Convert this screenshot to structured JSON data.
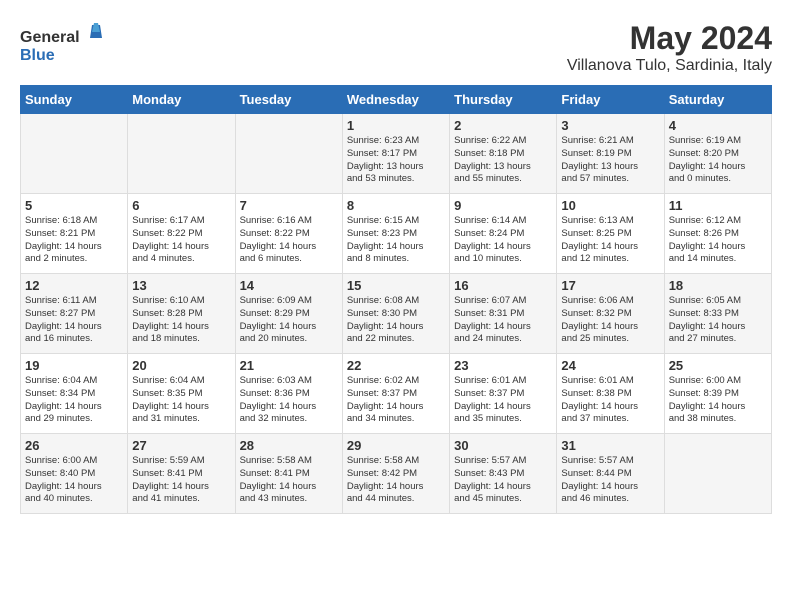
{
  "header": {
    "logo_general": "General",
    "logo_blue": "Blue",
    "month_year": "May 2024",
    "location": "Villanova Tulo, Sardinia, Italy"
  },
  "days_of_week": [
    "Sunday",
    "Monday",
    "Tuesday",
    "Wednesday",
    "Thursday",
    "Friday",
    "Saturday"
  ],
  "weeks": [
    [
      {
        "day": "",
        "info": ""
      },
      {
        "day": "",
        "info": ""
      },
      {
        "day": "",
        "info": ""
      },
      {
        "day": "1",
        "info": "Sunrise: 6:23 AM\nSunset: 8:17 PM\nDaylight: 13 hours\nand 53 minutes."
      },
      {
        "day": "2",
        "info": "Sunrise: 6:22 AM\nSunset: 8:18 PM\nDaylight: 13 hours\nand 55 minutes."
      },
      {
        "day": "3",
        "info": "Sunrise: 6:21 AM\nSunset: 8:19 PM\nDaylight: 13 hours\nand 57 minutes."
      },
      {
        "day": "4",
        "info": "Sunrise: 6:19 AM\nSunset: 8:20 PM\nDaylight: 14 hours\nand 0 minutes."
      }
    ],
    [
      {
        "day": "5",
        "info": "Sunrise: 6:18 AM\nSunset: 8:21 PM\nDaylight: 14 hours\nand 2 minutes."
      },
      {
        "day": "6",
        "info": "Sunrise: 6:17 AM\nSunset: 8:22 PM\nDaylight: 14 hours\nand 4 minutes."
      },
      {
        "day": "7",
        "info": "Sunrise: 6:16 AM\nSunset: 8:22 PM\nDaylight: 14 hours\nand 6 minutes."
      },
      {
        "day": "8",
        "info": "Sunrise: 6:15 AM\nSunset: 8:23 PM\nDaylight: 14 hours\nand 8 minutes."
      },
      {
        "day": "9",
        "info": "Sunrise: 6:14 AM\nSunset: 8:24 PM\nDaylight: 14 hours\nand 10 minutes."
      },
      {
        "day": "10",
        "info": "Sunrise: 6:13 AM\nSunset: 8:25 PM\nDaylight: 14 hours\nand 12 minutes."
      },
      {
        "day": "11",
        "info": "Sunrise: 6:12 AM\nSunset: 8:26 PM\nDaylight: 14 hours\nand 14 minutes."
      }
    ],
    [
      {
        "day": "12",
        "info": "Sunrise: 6:11 AM\nSunset: 8:27 PM\nDaylight: 14 hours\nand 16 minutes."
      },
      {
        "day": "13",
        "info": "Sunrise: 6:10 AM\nSunset: 8:28 PM\nDaylight: 14 hours\nand 18 minutes."
      },
      {
        "day": "14",
        "info": "Sunrise: 6:09 AM\nSunset: 8:29 PM\nDaylight: 14 hours\nand 20 minutes."
      },
      {
        "day": "15",
        "info": "Sunrise: 6:08 AM\nSunset: 8:30 PM\nDaylight: 14 hours\nand 22 minutes."
      },
      {
        "day": "16",
        "info": "Sunrise: 6:07 AM\nSunset: 8:31 PM\nDaylight: 14 hours\nand 24 minutes."
      },
      {
        "day": "17",
        "info": "Sunrise: 6:06 AM\nSunset: 8:32 PM\nDaylight: 14 hours\nand 25 minutes."
      },
      {
        "day": "18",
        "info": "Sunrise: 6:05 AM\nSunset: 8:33 PM\nDaylight: 14 hours\nand 27 minutes."
      }
    ],
    [
      {
        "day": "19",
        "info": "Sunrise: 6:04 AM\nSunset: 8:34 PM\nDaylight: 14 hours\nand 29 minutes."
      },
      {
        "day": "20",
        "info": "Sunrise: 6:04 AM\nSunset: 8:35 PM\nDaylight: 14 hours\nand 31 minutes."
      },
      {
        "day": "21",
        "info": "Sunrise: 6:03 AM\nSunset: 8:36 PM\nDaylight: 14 hours\nand 32 minutes."
      },
      {
        "day": "22",
        "info": "Sunrise: 6:02 AM\nSunset: 8:37 PM\nDaylight: 14 hours\nand 34 minutes."
      },
      {
        "day": "23",
        "info": "Sunrise: 6:01 AM\nSunset: 8:37 PM\nDaylight: 14 hours\nand 35 minutes."
      },
      {
        "day": "24",
        "info": "Sunrise: 6:01 AM\nSunset: 8:38 PM\nDaylight: 14 hours\nand 37 minutes."
      },
      {
        "day": "25",
        "info": "Sunrise: 6:00 AM\nSunset: 8:39 PM\nDaylight: 14 hours\nand 38 minutes."
      }
    ],
    [
      {
        "day": "26",
        "info": "Sunrise: 6:00 AM\nSunset: 8:40 PM\nDaylight: 14 hours\nand 40 minutes."
      },
      {
        "day": "27",
        "info": "Sunrise: 5:59 AM\nSunset: 8:41 PM\nDaylight: 14 hours\nand 41 minutes."
      },
      {
        "day": "28",
        "info": "Sunrise: 5:58 AM\nSunset: 8:41 PM\nDaylight: 14 hours\nand 43 minutes."
      },
      {
        "day": "29",
        "info": "Sunrise: 5:58 AM\nSunset: 8:42 PM\nDaylight: 14 hours\nand 44 minutes."
      },
      {
        "day": "30",
        "info": "Sunrise: 5:57 AM\nSunset: 8:43 PM\nDaylight: 14 hours\nand 45 minutes."
      },
      {
        "day": "31",
        "info": "Sunrise: 5:57 AM\nSunset: 8:44 PM\nDaylight: 14 hours\nand 46 minutes."
      },
      {
        "day": "",
        "info": ""
      }
    ]
  ]
}
